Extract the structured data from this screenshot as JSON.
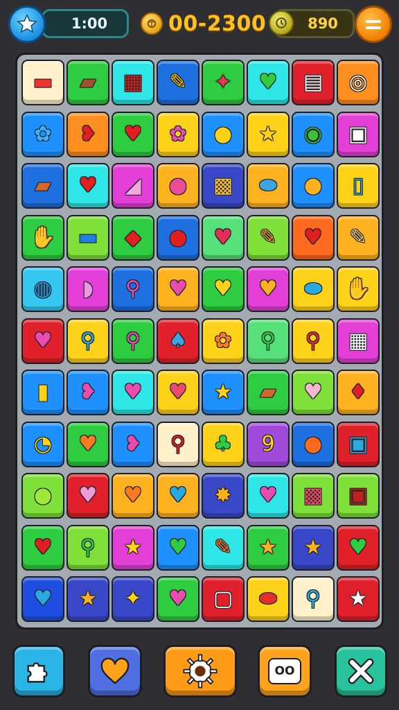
{
  "hud": {
    "timer": "1:00",
    "score": "00-2300",
    "energy": "890",
    "star_icon": "star-icon",
    "coin_icon": "coin-icon",
    "energy_icon": "clock-coin-icon",
    "menu_icon": "menu-icon"
  },
  "board": {
    "rows": [
      [
        [
          "#fff1c9",
          "▬",
          "#e33"
        ],
        [
          "#2ecc40",
          "▰",
          "#a0522d"
        ],
        [
          "#2ee6e6",
          "▦",
          "#c22"
        ],
        [
          "#1e6fe0",
          "✎",
          "#f2c300"
        ],
        [
          "#2ecc40",
          "✦",
          "#e53950"
        ],
        [
          "#2ee6e6",
          "♥",
          "#2ecc40"
        ],
        [
          "#e0202a",
          "▤",
          "#fff"
        ],
        [
          "#ff8f1f",
          "◎",
          "#fff"
        ]
      ],
      [
        [
          "#1e90ff",
          "✿",
          "#34b3ff"
        ],
        [
          "#ff8f1f",
          "❥",
          "#e02020"
        ],
        [
          "#2ecc40",
          "♥",
          "#e02020"
        ],
        [
          "#ffd21a",
          "✿",
          "#e94cb0"
        ],
        [
          "#1e90ff",
          "●",
          "#ffd21a"
        ],
        [
          "#ffd21a",
          "★",
          "#ffd21a"
        ],
        [
          "#1e90ff",
          "◉",
          "#3cbf3c"
        ],
        [
          "#e33fd6",
          "▣",
          "#fff"
        ]
      ],
      [
        [
          "#1e6fe0",
          "▰",
          "#d06a2c"
        ],
        [
          "#2ee6e6",
          "♥",
          "#e02020"
        ],
        [
          "#e33fd6",
          "◢",
          "#f6a7e0"
        ],
        [
          "#ffb21f",
          "●",
          "#e94c9a"
        ],
        [
          "#3848c8",
          "▩",
          "#f7c437"
        ],
        [
          "#ffb21f",
          "⬬",
          "#3aa6e0"
        ],
        [
          "#1e90ff",
          "●",
          "#ffb21f"
        ],
        [
          "#ffd21a",
          "▯",
          "#2aa8e0"
        ]
      ],
      [
        [
          "#2ecc40",
          "✋",
          "#ffb21f"
        ],
        [
          "#7ee038",
          "▬",
          "#1e7fe0"
        ],
        [
          "#2ecc40",
          "◆",
          "#e02020"
        ],
        [
          "#1e6fe0",
          "●",
          "#e02020"
        ],
        [
          "#56e07a",
          "♥",
          "#e0305a"
        ],
        [
          "#7ee038",
          "✎",
          "#f0a020"
        ],
        [
          "#ff6a1f",
          "♥",
          "#e02020"
        ],
        [
          "#ffb21f",
          "✎",
          "#f7d27a"
        ]
      ],
      [
        [
          "#34c7f0",
          "◍",
          "#2d95e0"
        ],
        [
          "#e33fd6",
          "◗",
          "#e89ae0"
        ],
        [
          "#1e6fe0",
          "⚲",
          "#e94cb0"
        ],
        [
          "#ffb21f",
          "♥",
          "#e94cb0"
        ],
        [
          "#2ecc40",
          "♥",
          "#ffd21a"
        ],
        [
          "#e33fd6",
          "♥",
          "#ffb21f"
        ],
        [
          "#ffd21a",
          "⬬",
          "#2aa8e0"
        ],
        [
          "#ffd21a",
          "✋",
          "#2d8fe0"
        ]
      ],
      [
        [
          "#e0202a",
          "♥",
          "#e94cb0"
        ],
        [
          "#ffd21a",
          "⚲",
          "#2aa8e0"
        ],
        [
          "#2ecc40",
          "⚲",
          "#e94cb0"
        ],
        [
          "#e0202a",
          "♠",
          "#3aa6e0"
        ],
        [
          "#ffd21a",
          "✿",
          "#ff7a1f"
        ],
        [
          "#56e07a",
          "⚲",
          "#2ecc40"
        ],
        [
          "#ffd21a",
          "⚲",
          "#e0302a"
        ],
        [
          "#e33fd6",
          "▦",
          "#fff"
        ]
      ],
      [
        [
          "#1e90ff",
          "▮",
          "#ffd21a"
        ],
        [
          "#1e90ff",
          "❥",
          "#e94cb0"
        ],
        [
          "#2ee6e6",
          "♥",
          "#e94cb0"
        ],
        [
          "#ffd21a",
          "♥",
          "#e94c6a"
        ],
        [
          "#1e90ff",
          "★",
          "#ffd21a"
        ],
        [
          "#2ecc40",
          "▰",
          "#d06a2c"
        ],
        [
          "#7ee038",
          "♥",
          "#f6b7d0"
        ],
        [
          "#ffb21f",
          "♦",
          "#e02020"
        ]
      ],
      [
        [
          "#1e90ff",
          "◔",
          "#ffd21a"
        ],
        [
          "#2ecc40",
          "♥",
          "#ff7a1f"
        ],
        [
          "#1e90ff",
          "❥",
          "#e94cb0"
        ],
        [
          "#fff1c9",
          "⚲",
          "#e02020"
        ],
        [
          "#ffd21a",
          "♣",
          "#2ecc40"
        ],
        [
          "#a14bdc",
          "9",
          "#ffd21a"
        ],
        [
          "#1e6fe0",
          "●",
          "#ff6a1f"
        ],
        [
          "#e0202a",
          "▣",
          "#2aa8e0"
        ]
      ],
      [
        [
          "#7ee038",
          "●",
          "#9ee83a"
        ],
        [
          "#e0202a",
          "♥",
          "#f29ad6"
        ],
        [
          "#ffb21f",
          "♥",
          "#ff7a1f"
        ],
        [
          "#ffb21f",
          "♥",
          "#2aa8e0"
        ],
        [
          "#3848c8",
          "✸",
          "#ffb21f"
        ],
        [
          "#2ee6e6",
          "♥",
          "#e94cb0"
        ],
        [
          "#7ee038",
          "▩",
          "#e94c6a"
        ],
        [
          "#7ee038",
          "▣",
          "#c02020"
        ]
      ],
      [
        [
          "#2ecc40",
          "♥",
          "#e02020"
        ],
        [
          "#7ee038",
          "⚲",
          "#2ecc40"
        ],
        [
          "#e33fd6",
          "★",
          "#ffd21a"
        ],
        [
          "#1e90ff",
          "♥",
          "#2ecc40"
        ],
        [
          "#2ee6e6",
          "✎",
          "#ff7a1f"
        ],
        [
          "#2ecc40",
          "★",
          "#ffb21f"
        ],
        [
          "#3848c8",
          "★",
          "#ffb21f"
        ],
        [
          "#e0202a",
          "♥",
          "#2ecc40"
        ]
      ],
      [
        [
          "#1e4fe0",
          "♥",
          "#2aa8e0"
        ],
        [
          "#3848c8",
          "★",
          "#ffb21f"
        ],
        [
          "#3848c8",
          "✦",
          "#ffd21a"
        ],
        [
          "#2ecc40",
          "♥",
          "#e94cb0"
        ],
        [
          "#e0202a",
          "▢",
          "#fff"
        ],
        [
          "#ffd21a",
          "⬬",
          "#e0302a"
        ],
        [
          "#fff1c9",
          "⚲",
          "#2aa8e0"
        ],
        [
          "#e0202a",
          "★",
          "#fff"
        ]
      ]
    ]
  },
  "toolbar": {
    "puzzle_icon": "puzzle-icon",
    "heart_icon": "heart-icon",
    "gear_icon": "gear-icon",
    "pause_label": "OO",
    "close_icon": "close-icon"
  }
}
